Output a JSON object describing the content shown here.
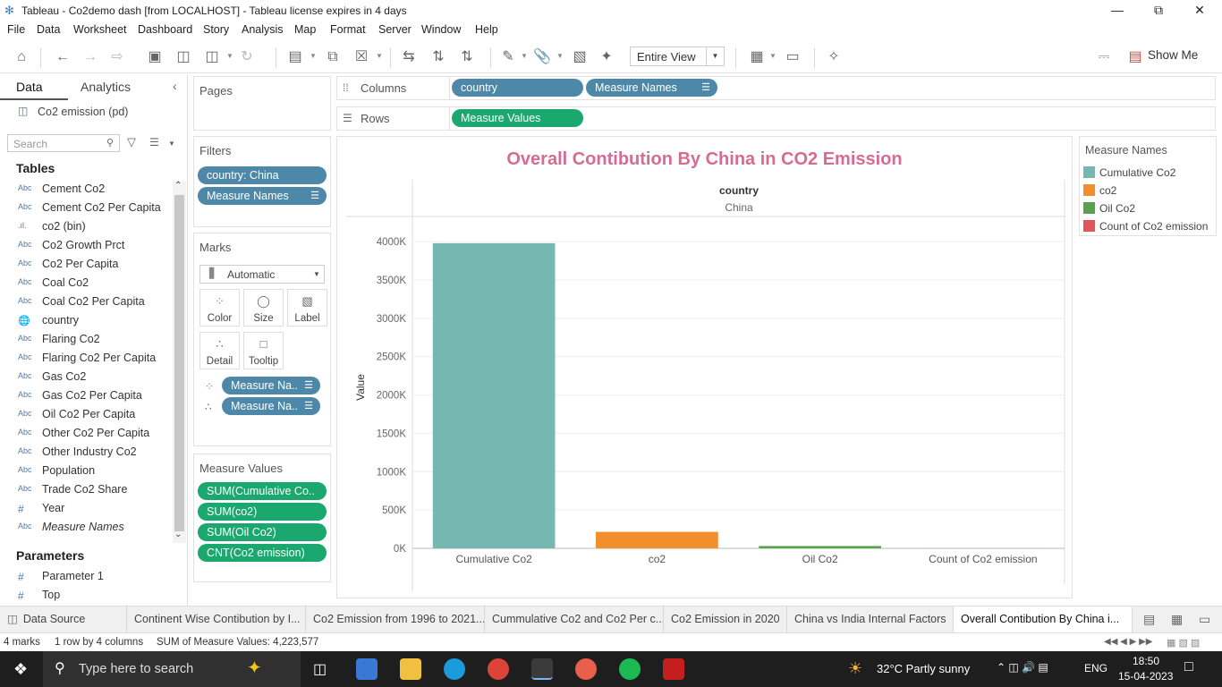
{
  "window": {
    "title": "Tableau - Co2demo dash [from LOCALHOST] - Tableau license expires in 4 days"
  },
  "menu": [
    "File",
    "Data",
    "Worksheet",
    "Dashboard",
    "Story",
    "Analysis",
    "Map",
    "Format",
    "Server",
    "Window",
    "Help"
  ],
  "toolbar": {
    "view_mode": "Entire View",
    "show_me": "Show Me"
  },
  "data_pane": {
    "tab_data": "Data",
    "tab_analytics": "Analytics",
    "datasource": "Co2 emission (pd)",
    "search_placeholder": "Search",
    "tables_header": "Tables",
    "fields": [
      {
        "type": "Abc",
        "name": "Cement Co2"
      },
      {
        "type": "Abc",
        "name": "Cement Co2 Per Capita"
      },
      {
        "type": ".ıl.",
        "name": "co2 (bin)"
      },
      {
        "type": "Abc",
        "name": "Co2 Growth Prct"
      },
      {
        "type": "Abc",
        "name": "Co2 Per Capita"
      },
      {
        "type": "Abc",
        "name": "Coal Co2"
      },
      {
        "type": "Abc",
        "name": "Coal Co2 Per Capita"
      },
      {
        "type": "globe",
        "name": "country"
      },
      {
        "type": "Abc",
        "name": "Flaring Co2"
      },
      {
        "type": "Abc",
        "name": "Flaring Co2 Per Capita"
      },
      {
        "type": "Abc",
        "name": "Gas Co2"
      },
      {
        "type": "Abc",
        "name": "Gas Co2 Per Capita"
      },
      {
        "type": "Abc",
        "name": "Oil Co2 Per Capita"
      },
      {
        "type": "Abc",
        "name": "Other Co2 Per Capita"
      },
      {
        "type": "Abc",
        "name": "Other Industry Co2"
      },
      {
        "type": "Abc",
        "name": "Population"
      },
      {
        "type": "Abc",
        "name": "Trade Co2 Share"
      },
      {
        "type": "#",
        "name": "Year"
      },
      {
        "type": "Abc",
        "name": "Measure Names"
      }
    ],
    "parameters_header": "Parameters",
    "parameters": [
      {
        "type": "#",
        "name": "Parameter 1"
      },
      {
        "type": "#",
        "name": "Top"
      }
    ]
  },
  "shelves": {
    "pages_label": "Pages",
    "filters_label": "Filters",
    "filters": [
      "country: China",
      "Measure Names"
    ],
    "marks_label": "Marks",
    "marks_type": "Automatic",
    "mark_buttons": [
      "Color",
      "Size",
      "Label",
      "Detail",
      "Tooltip"
    ],
    "marks_pills": [
      "Measure Na..",
      "Measure Na.."
    ],
    "measure_values_label": "Measure Values",
    "measure_values": [
      "SUM(Cumulative Co..",
      "SUM(co2)",
      "SUM(Oil Co2)",
      "CNT(Co2 emission)"
    ],
    "columns_label": "Columns",
    "columns": [
      "country",
      "Measure Names"
    ],
    "rows_label": "Rows",
    "rows": [
      "Measure Values"
    ]
  },
  "legend": {
    "title": "Measure Names",
    "items": [
      {
        "label": "Cumulative Co2",
        "color": "#76b7b2"
      },
      {
        "label": "co2",
        "color": "#f28e2b"
      },
      {
        "label": "Oil Co2",
        "color": "#59a14f"
      },
      {
        "label": "Count of Co2 emission",
        "color": "#e15759"
      }
    ]
  },
  "chart_data": {
    "type": "bar",
    "title": "Overall Contibution By China in CO2 Emission",
    "header_field": "country",
    "header_value": "China",
    "ylabel": "Value",
    "xlabel": "",
    "categories": [
      "Cumulative Co2",
      "co2",
      "Oil Co2",
      "Count of Co2 emission"
    ],
    "values": [
      3980000,
      215000,
      30000,
      100
    ],
    "colors": [
      "#76b7b2",
      "#f28e2b",
      "#59a14f",
      "#e15759"
    ],
    "ylim": [
      0,
      4200000
    ],
    "yticks": [
      0,
      500000,
      1000000,
      1500000,
      2000000,
      2500000,
      3000000,
      3500000,
      4000000
    ],
    "ytick_labels": [
      "0K",
      "500K",
      "1000K",
      "1500K",
      "2000K",
      "2500K",
      "3000K",
      "3500K",
      "4000K"
    ],
    "grid": true
  },
  "sheet_tabs": [
    "Data Source",
    "Continent Wise Contibution by I...",
    "Co2 Emission from 1996 to 2021...",
    "Cummulative Co2 and Co2 Per c...",
    "Co2 Emission in 2020",
    "China vs India Internal Factors",
    "Overall Contibution By China i..."
  ],
  "status": {
    "marks": "4 marks",
    "rows": "1 row by 4 columns",
    "sum": "SUM of Measure Values: 4,223,577"
  },
  "taskbar": {
    "search_placeholder": "Type here to search",
    "weather": "32°C  Partly sunny",
    "lang": "ENG",
    "time": "18:50",
    "date": "15-04-2023"
  }
}
